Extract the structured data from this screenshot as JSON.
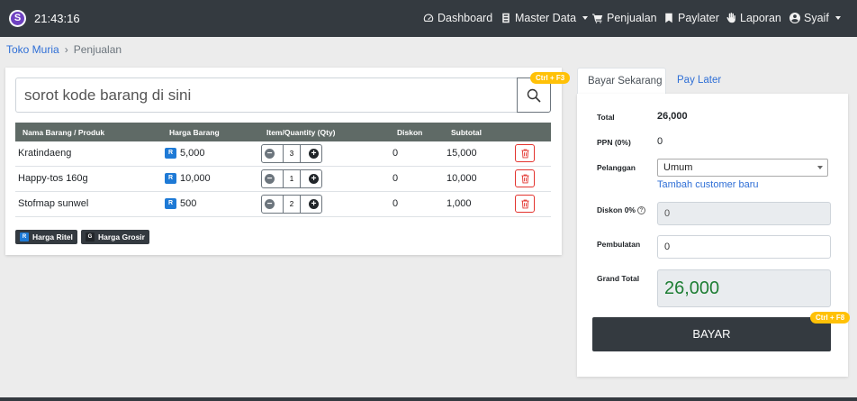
{
  "navbar": {
    "logo_letter": "S",
    "clock": "21:43:16",
    "items": [
      {
        "label": "Dashboard",
        "icon": "dashboard-icon"
      },
      {
        "label": "Master Data",
        "icon": "database-icon"
      },
      {
        "label": "Penjualan",
        "icon": "cart-icon"
      },
      {
        "label": "Paylater",
        "icon": "bookmark-icon"
      },
      {
        "label": "Laporan",
        "icon": "hand-icon"
      },
      {
        "label": "Syaif",
        "icon": "user-icon"
      }
    ]
  },
  "breadcrumb": {
    "home": "Toko Muria",
    "separator": "›",
    "current": "Penjualan"
  },
  "search": {
    "placeholder": "sorot kode barang di sini",
    "shortcut": "Ctrl + F3"
  },
  "table": {
    "headers": [
      "Nama Barang / Produk",
      "Harga Barang",
      "Item/Quantity (Qty)",
      "Diskon",
      "Subtotal"
    ],
    "rows": [
      {
        "name": "Kratindaeng",
        "price_badge": "R",
        "price": "5,000",
        "qty": "3",
        "discount": "0",
        "subtotal": "15,000"
      },
      {
        "name": "Happy-tos 160g",
        "price_badge": "R",
        "price": "10,000",
        "qty": "1",
        "discount": "0",
        "subtotal": "10,000"
      },
      {
        "name": "Stofmap sunwel",
        "price_badge": "R",
        "price": "500",
        "qty": "2",
        "discount": "0",
        "subtotal": "1,000"
      }
    ]
  },
  "legend": [
    {
      "badge": "R",
      "label": "Harga Ritel",
      "color": "#1e7ad6"
    },
    {
      "badge": "G",
      "label": "Harga Grosir",
      "color": "#212529"
    }
  ],
  "tabs": {
    "active": "Bayar Sekarang",
    "inactive": "Pay Later"
  },
  "payment": {
    "total_label": "Total",
    "total_value": "26,000",
    "ppn_label": "PPN (0%)",
    "ppn_value": "0",
    "customer_label": "Pelanggan",
    "customer_value": "Umum",
    "add_customer": "Tambah customer baru",
    "discount_label": "Diskon 0%",
    "discount_value": "0",
    "rounding_label": "Pembulatan",
    "rounding_value": "0",
    "grand_total_label": "Grand Total",
    "grand_total_value": "26,000",
    "pay_button": "BAYAR",
    "pay_shortcut": "Ctrl + F8"
  },
  "colors": {
    "navbar": "#343a40",
    "link": "#2f6fd6",
    "accent_badge": "#ffc107",
    "danger": "#e3342f",
    "grand_total": "#1e7e34"
  }
}
